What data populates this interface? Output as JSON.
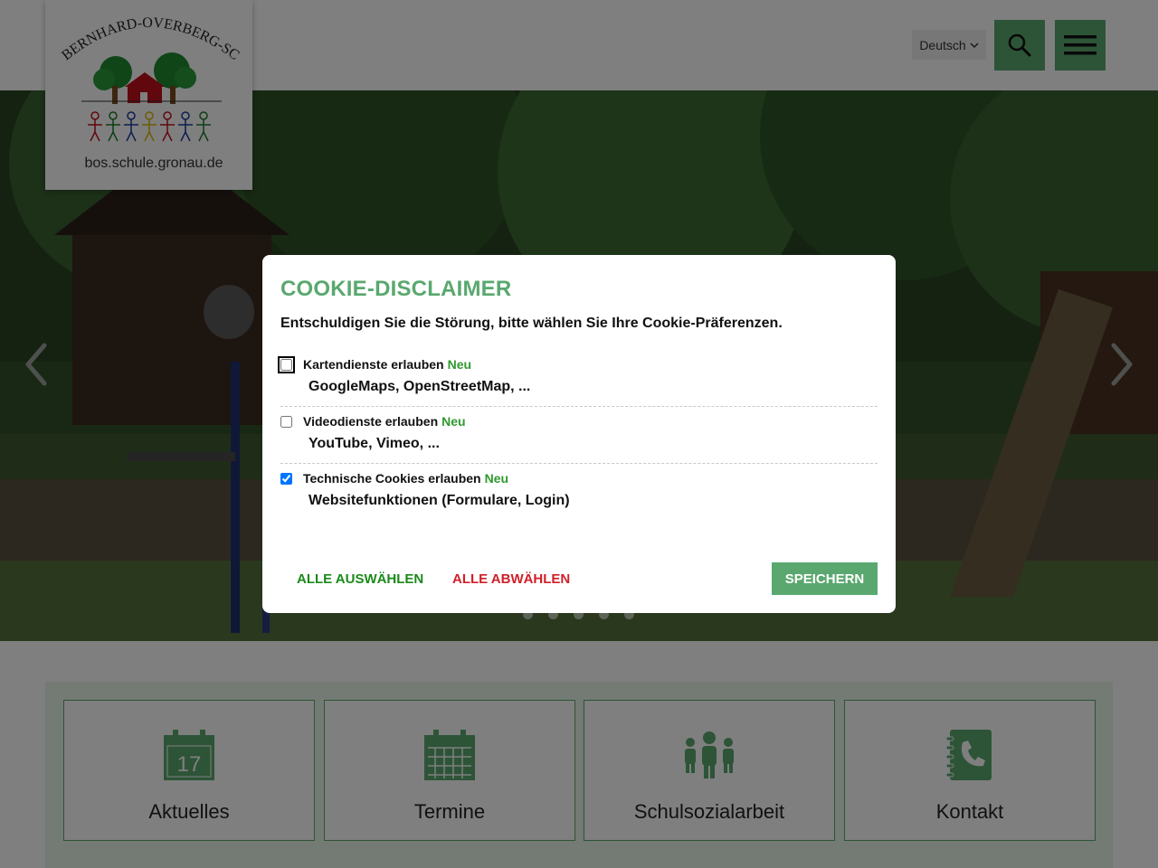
{
  "header": {
    "logo": {
      "arc_text": "BERNHARD-OVERBERG-SCHULE",
      "url_text": "bos.schule.gronau.de"
    },
    "language": "Deutsch",
    "icons": {
      "search": "search-icon",
      "menu": "hamburger-menu-icon",
      "chevron": "chevron-down-icon"
    }
  },
  "hero": {
    "arrows": [
      "chevron-left-icon",
      "chevron-right-icon"
    ],
    "dots_count": 5
  },
  "tiles": [
    {
      "label": "Aktuelles",
      "icon": "calendar-day-icon",
      "day": "17"
    },
    {
      "label": "Termine",
      "icon": "calendar-grid-icon"
    },
    {
      "label": "Schulsozialarbeit",
      "icon": "people-group-icon"
    },
    {
      "label": "Kontakt",
      "icon": "phone-book-icon"
    }
  ],
  "cookie": {
    "title": "COOKIE-DISCLAIMER",
    "intro": "Entschuldigen Sie die Störung, bitte wählen Sie Ihre Cookie-Präferenzen.",
    "options": [
      {
        "label": "Kartendienste erlauben",
        "badge": "Neu",
        "description": "GoogleMaps, OpenStreetMap, ...",
        "checked": false
      },
      {
        "label": "Videodienste erlauben",
        "badge": "Neu",
        "description": "YouTube, Vimeo, ...",
        "checked": false
      },
      {
        "label": "Technische Cookies erlauben",
        "badge": "Neu",
        "description": "Websitefunktionen (Formulare, Login)",
        "checked": true
      }
    ],
    "select_all": "ALLE AUSWÄHLEN",
    "deselect_all": "ALLE ABWÄHLEN",
    "save": "SPEICHERN"
  },
  "colors": {
    "brand_green": "#5aa86f",
    "badge_green": "#2e9a2e",
    "deselect_red": "#d0202a",
    "panel_bg": "#e9f5e8"
  }
}
